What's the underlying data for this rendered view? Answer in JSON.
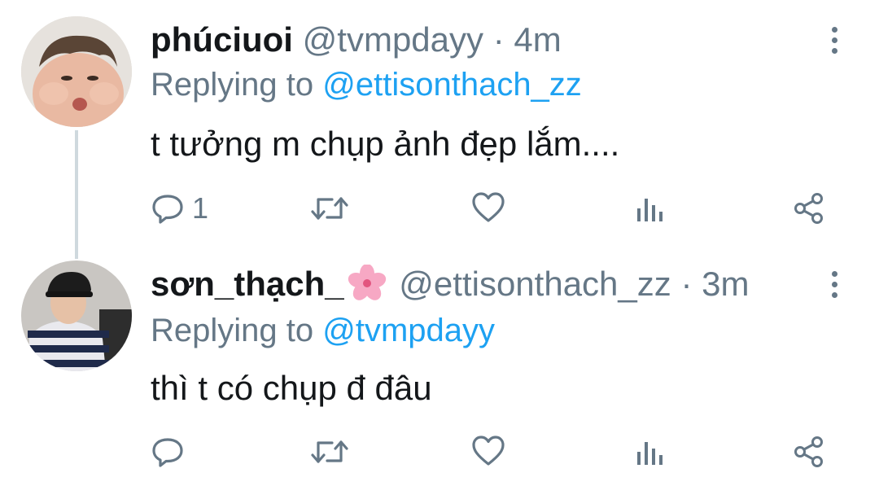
{
  "tweets": [
    {
      "name": "phúciuoi",
      "handle": "@tvmpdayy",
      "separator": "·",
      "time": "4m",
      "reply_prefix": "Replying to",
      "reply_to": "@ettisonthach_zz",
      "text": "t tưởng m chụp ảnh đẹp lắm....",
      "reply_count": "1",
      "icons": [
        "reply-icon",
        "retweet-icon",
        "like-icon",
        "analytics-icon",
        "share-icon",
        "more-icon"
      ]
    },
    {
      "name": "sơn_thạch_",
      "name_emoji": "cherry-blossom",
      "handle": "@ettisonthach_zz",
      "separator": "·",
      "time": "3m",
      "reply_prefix": "Replying to",
      "reply_to": "@tvmpdayy",
      "text": "thì t có chụp đ đâu",
      "reply_count": "",
      "icons": [
        "reply-icon",
        "retweet-icon",
        "like-icon",
        "analytics-icon",
        "share-icon",
        "more-icon"
      ]
    }
  ],
  "colors": {
    "primary_text": "#14171a",
    "secondary_text": "#657786",
    "mention": "#1da1f2",
    "thread_line": "#cfd9de",
    "emoji_pink": "#f7a8c4"
  }
}
